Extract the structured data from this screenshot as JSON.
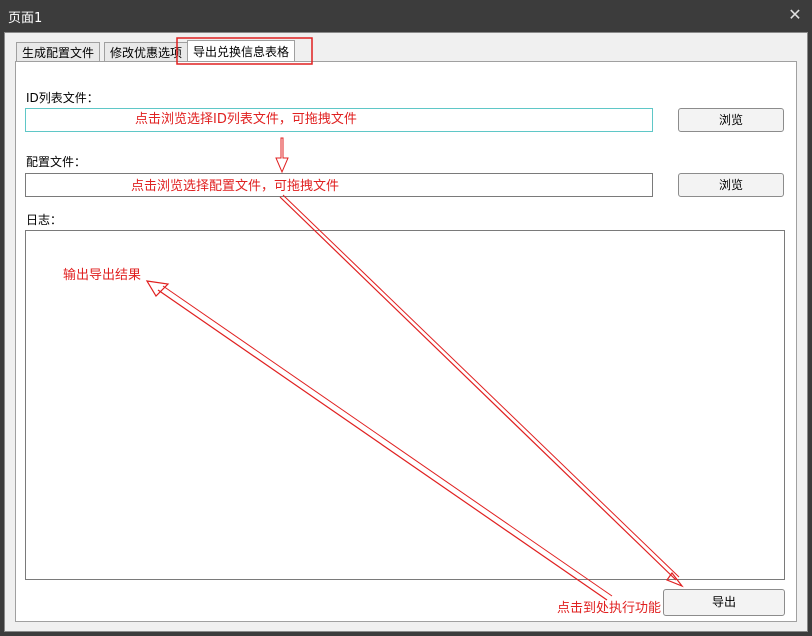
{
  "window": {
    "title": "页面1",
    "close_icon": "close-icon"
  },
  "tabs": [
    {
      "label": "生成配置文件"
    },
    {
      "label": "修改优惠选项"
    },
    {
      "label": "导出兑换信息表格"
    }
  ],
  "form": {
    "id_list_label": "ID列表文件：",
    "config_label": "配置文件：",
    "log_label": "日志：",
    "browse_label": "浏览",
    "export_label": "导出"
  },
  "annotations": {
    "id_list_hint": "点击浏览选择ID列表文件，可拖拽文件",
    "config_hint": "点击浏览选择配置文件，可拖拽文件",
    "log_hint": "输出导出结果",
    "export_hint": "点击到处执行功能",
    "color": "#e02020"
  }
}
